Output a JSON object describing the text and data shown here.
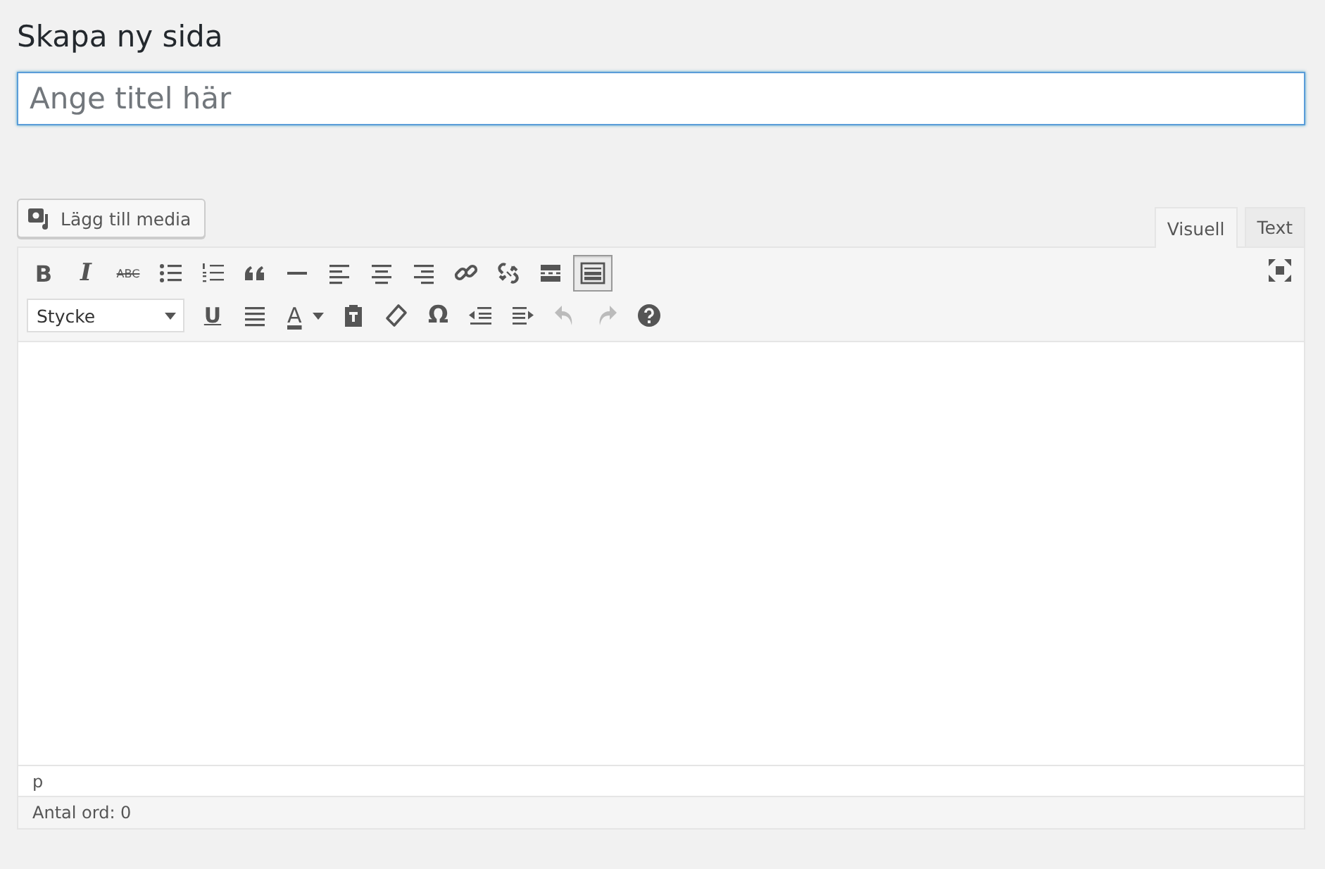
{
  "heading": "Skapa ny sida",
  "title_field": {
    "placeholder": "Ange titel här"
  },
  "media_button": {
    "label": "Lägg till media"
  },
  "tabs": [
    {
      "label": "Visuell",
      "selected": true
    },
    {
      "label": "Text",
      "selected": false
    }
  ],
  "toolbar_rows": [
    [
      {
        "kind": "bold",
        "glyph": "B"
      },
      {
        "kind": "italic",
        "glyph": "I"
      },
      {
        "kind": "strike",
        "glyph": "ABC"
      },
      {
        "kind": "bullets"
      },
      {
        "kind": "numbers"
      },
      {
        "kind": "quote"
      },
      {
        "kind": "hr"
      },
      {
        "kind": "align-left"
      },
      {
        "kind": "align-center"
      },
      {
        "kind": "align-right"
      },
      {
        "kind": "link"
      },
      {
        "kind": "unlink"
      },
      {
        "kind": "more"
      },
      {
        "kind": "toolbar-toggle",
        "selected": true
      }
    ],
    [
      {
        "kind": "format",
        "value": "Stycke"
      },
      {
        "kind": "underline",
        "glyph": "U"
      },
      {
        "kind": "justify"
      },
      {
        "kind": "text-color",
        "glyph": "A"
      },
      {
        "kind": "paste-text"
      },
      {
        "kind": "eraser"
      },
      {
        "kind": "special-char",
        "glyph": "Ω"
      },
      {
        "kind": "outdent"
      },
      {
        "kind": "indent"
      },
      {
        "kind": "undo",
        "disabled": true
      },
      {
        "kind": "redo",
        "disabled": true
      },
      {
        "kind": "help"
      }
    ]
  ],
  "path_bar": "p",
  "word_count": "Antal ord: 0"
}
